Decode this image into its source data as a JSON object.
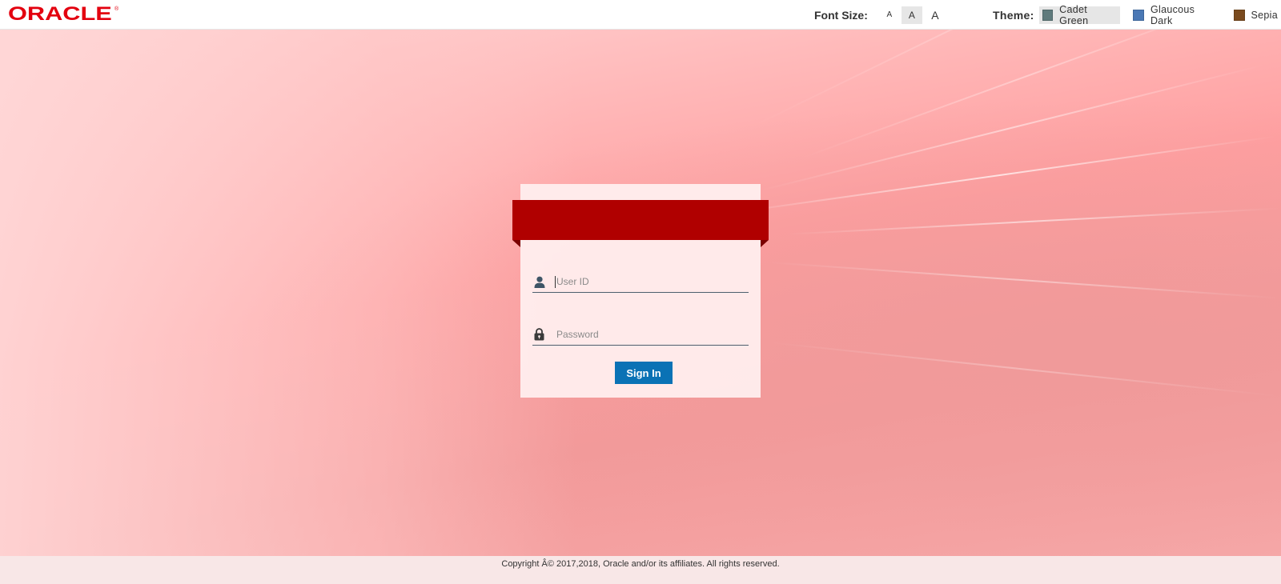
{
  "header": {
    "logo_text": "ORACLE",
    "logo_mark": "®",
    "font_size": {
      "label": "Font Size:",
      "options": [
        "A",
        "A",
        "A"
      ],
      "selected_index": 1
    },
    "theme": {
      "label": "Theme:",
      "options": [
        {
          "label": "Cadet Green",
          "color": "#5f7a7c",
          "selected": true
        },
        {
          "label": "Glaucous Dark",
          "color": "#4a78b5",
          "selected": false
        },
        {
          "label": "Sepia",
          "color": "#7a4a1e",
          "selected": false
        }
      ]
    }
  },
  "login": {
    "ribbon_color": "#b00000",
    "user_id_placeholder": "User ID",
    "user_id_value": "",
    "password_placeholder": "Password",
    "password_value": "",
    "sign_in_label": "Sign In",
    "icons": {
      "user": "user-icon",
      "password": "lock-icon"
    }
  },
  "footer": {
    "copyright": "Copyright Â© 2017,2018, Oracle and/or its affiliates. All rights reserved."
  },
  "colors": {
    "brand": "#e3000f",
    "button": "#0a72b5"
  }
}
